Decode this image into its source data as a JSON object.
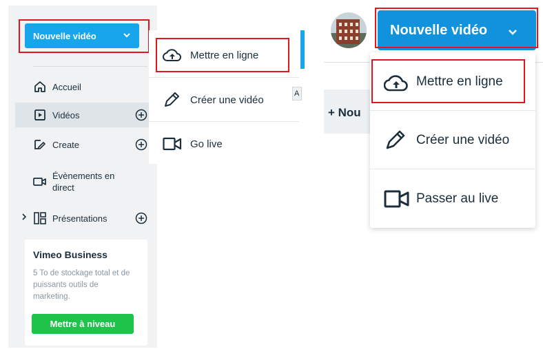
{
  "left_panel": {
    "new_video_label": "Nouvelle vidéo",
    "nav": [
      {
        "label": "Accueil",
        "icon": "home-icon"
      },
      {
        "label": "Vidéos",
        "icon": "video-file-icon"
      },
      {
        "label": "Create",
        "icon": "create-icon"
      },
      {
        "label": "Évènements en direct",
        "icon": "camera-icon"
      },
      {
        "label": "Présentations",
        "icon": "showcase-grid-icon"
      }
    ],
    "business": {
      "title": "Vimeo Business",
      "text": "5 To de stockage total et de puissants outils de marketing.",
      "button": "Mettre à niveau"
    }
  },
  "middle_menu": {
    "items": [
      {
        "label": "Mettre en ligne",
        "icon": "cloud-upload-icon"
      },
      {
        "label": "Créer une vidéo",
        "icon": "pencil-icon"
      },
      {
        "label": "Go live",
        "icon": "video-camera-icon"
      }
    ],
    "side_tab": "A"
  },
  "right_panel": {
    "new_video_label": "Nouvelle vidéo",
    "partial_text": "+ Nou",
    "items": [
      {
        "label": "Mettre en ligne",
        "icon": "cloud-upload-icon"
      },
      {
        "label": "Créer une vidéo",
        "icon": "pencil-icon"
      },
      {
        "label": "Passer au live",
        "icon": "video-camera-icon"
      }
    ]
  },
  "colors": {
    "primary_blue": "#17a6ec",
    "highlight_red": "#e5141c",
    "upgrade_green": "#1fc34a"
  }
}
